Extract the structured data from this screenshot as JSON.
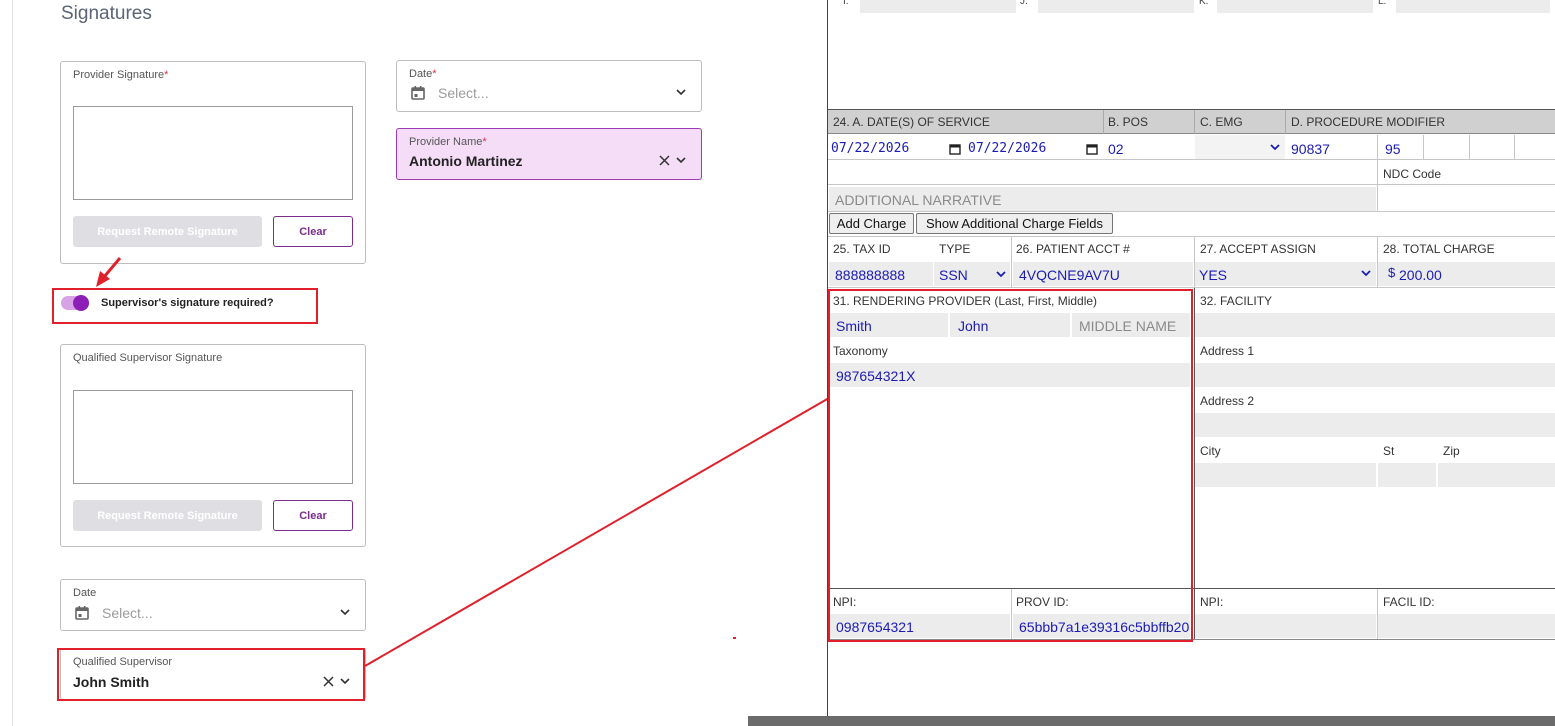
{
  "left": {
    "section_title": "Signatures",
    "provider_signature": {
      "label": "Provider Signature",
      "required_mark": "*",
      "request_button": "Request Remote Signature",
      "clear_button": "Clear"
    },
    "date_1": {
      "label": "Date",
      "required_mark": "*",
      "placeholder": "Select..."
    },
    "provider_name": {
      "label": "Provider Name",
      "required_mark": "*",
      "value": "Antonio Martinez"
    },
    "supervisor_toggle": {
      "label": "Supervisor's signature required?",
      "on": true
    },
    "supervisor_signature": {
      "label": "Qualified Supervisor Signature",
      "request_button": "Request Remote Signature",
      "clear_button": "Clear"
    },
    "date_2": {
      "label": "Date",
      "placeholder": "Select..."
    },
    "qualified_supervisor": {
      "label": "Qualified Supervisor",
      "value": "John Smith"
    }
  },
  "form": {
    "top_letters": [
      "I.",
      "J.",
      "K.",
      "L."
    ],
    "service_header": {
      "date_of_service": "24. A. DATE(S) OF SERVICE",
      "pos": "B. POS",
      "emg": "C. EMG",
      "procedure": "D. PROCEDURE MODIFIER"
    },
    "service_row": {
      "date_from": "07/22/2026",
      "date_to": "07/22/2026",
      "pos": "02",
      "emg": "",
      "procedure": "90837",
      "modifier": "95"
    },
    "ndc_label": "NDC Code",
    "narrative_placeholder": "ADDITIONAL NARRATIVE",
    "add_charge_button": "Add Charge",
    "show_fields_button": "Show Additional Charge Fields",
    "tax_id": {
      "label": "25. TAX ID",
      "value": "888888888"
    },
    "type": {
      "label": "TYPE",
      "value": "SSN"
    },
    "patient_acct": {
      "label": "26. PATIENT ACCT #",
      "value": "4VQCNE9AV7U"
    },
    "accept_assign": {
      "label": "27. ACCEPT ASSIGN",
      "value": "YES"
    },
    "total_charge": {
      "label": "28. TOTAL CHARGE",
      "currency": "$",
      "value": "200.00"
    },
    "rendering_provider": {
      "label": "31. RENDERING PROVIDER (Last, First, Middle)",
      "last": "Smith",
      "first": "John",
      "middle_placeholder": "MIDDLE NAME",
      "taxonomy_label": "Taxonomy",
      "taxonomy": "987654321X",
      "npi_label": "NPI:",
      "npi": "0987654321",
      "prov_id_label": "PROV ID:",
      "prov_id": "65bbb7a1e39316c5bbffb20"
    },
    "facility": {
      "label": "32. FACILITY",
      "address1_label": "Address 1",
      "address2_label": "Address 2",
      "city_label": "City",
      "st_label": "St",
      "zip_label": "Zip",
      "npi_label": "NPI:",
      "facil_id_label": "FACIL ID:"
    }
  },
  "colors": {
    "accent_purple": "#7b2d8e",
    "highlight_red": "#e0202a",
    "form_value_blue": "#1b1bb5"
  }
}
